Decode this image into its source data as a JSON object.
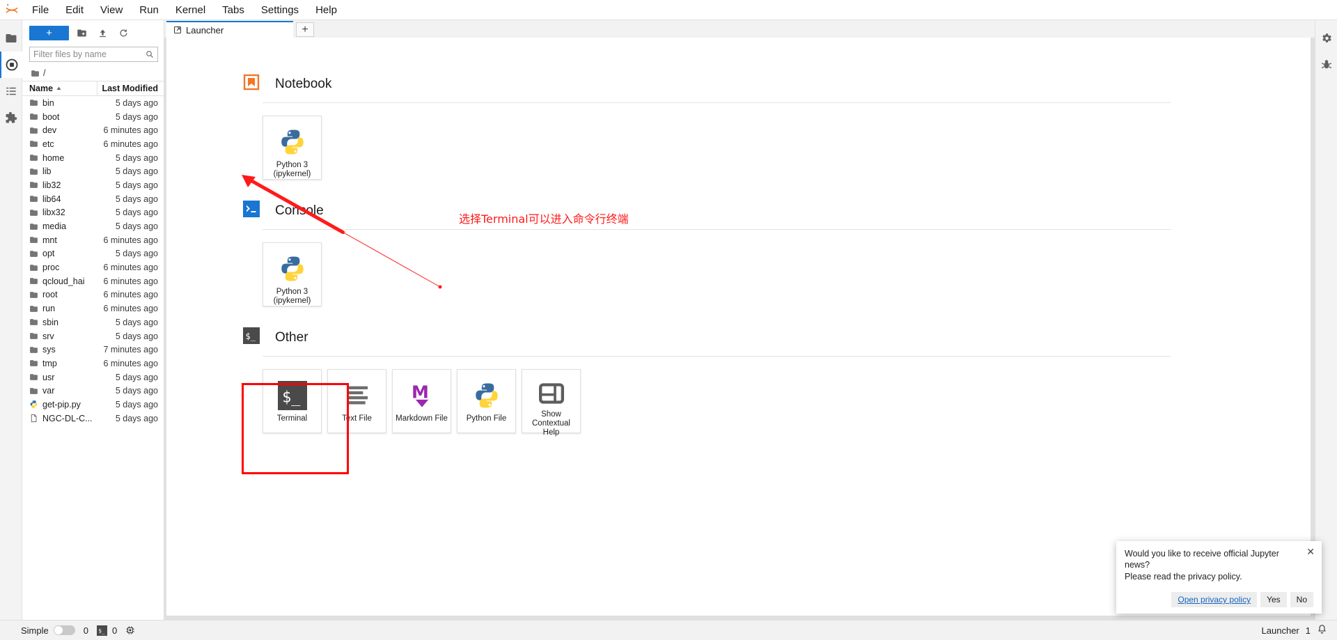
{
  "app": {
    "title": "JupyterLab",
    "logo_icon": "jupyter-logo-icon"
  },
  "menubar": {
    "items": [
      {
        "label": "File"
      },
      {
        "label": "Edit"
      },
      {
        "label": "View"
      },
      {
        "label": "Run"
      },
      {
        "label": "Kernel"
      },
      {
        "label": "Tabs"
      },
      {
        "label": "Settings"
      },
      {
        "label": "Help"
      }
    ]
  },
  "activitybar": {
    "items": [
      {
        "name": "file-browser-icon",
        "label": "File Browser"
      },
      {
        "name": "running-terminals-icon",
        "label": "Running Terminals and Kernels"
      },
      {
        "name": "table-of-contents-icon",
        "label": "Table of Contents"
      },
      {
        "name": "extension-manager-icon",
        "label": "Extension Manager"
      }
    ]
  },
  "rightbar": {
    "items": [
      {
        "name": "property-inspector-icon",
        "label": "Property Inspector"
      },
      {
        "name": "debugger-icon",
        "label": "Debugger"
      }
    ]
  },
  "filebrowser": {
    "new_launcher_label": "+",
    "toolbar_icons": [
      {
        "name": "new-folder-icon",
        "label": "New Folder"
      },
      {
        "name": "upload-icon",
        "label": "Upload Files"
      },
      {
        "name": "refresh-icon",
        "label": "Refresh File List"
      }
    ],
    "filter": {
      "placeholder": "Filter files by name",
      "value": ""
    },
    "breadcrumb": {
      "root": "/"
    },
    "columns": {
      "name": "Name",
      "last_modified": "Last Modified"
    },
    "sort": {
      "column": "Name",
      "direction": "ascending"
    },
    "items": [
      {
        "name": "bin",
        "modified": "5 days ago",
        "type": "folder"
      },
      {
        "name": "boot",
        "modified": "5 days ago",
        "type": "folder"
      },
      {
        "name": "dev",
        "modified": "6 minutes ago",
        "type": "folder"
      },
      {
        "name": "etc",
        "modified": "6 minutes ago",
        "type": "folder"
      },
      {
        "name": "home",
        "modified": "5 days ago",
        "type": "folder"
      },
      {
        "name": "lib",
        "modified": "5 days ago",
        "type": "folder"
      },
      {
        "name": "lib32",
        "modified": "5 days ago",
        "type": "folder"
      },
      {
        "name": "lib64",
        "modified": "5 days ago",
        "type": "folder"
      },
      {
        "name": "libx32",
        "modified": "5 days ago",
        "type": "folder"
      },
      {
        "name": "media",
        "modified": "5 days ago",
        "type": "folder"
      },
      {
        "name": "mnt",
        "modified": "6 minutes ago",
        "type": "folder"
      },
      {
        "name": "opt",
        "modified": "5 days ago",
        "type": "folder"
      },
      {
        "name": "proc",
        "modified": "6 minutes ago",
        "type": "folder"
      },
      {
        "name": "qcloud_hai",
        "modified": "6 minutes ago",
        "type": "folder"
      },
      {
        "name": "root",
        "modified": "6 minutes ago",
        "type": "folder"
      },
      {
        "name": "run",
        "modified": "6 minutes ago",
        "type": "folder"
      },
      {
        "name": "sbin",
        "modified": "5 days ago",
        "type": "folder"
      },
      {
        "name": "srv",
        "modified": "5 days ago",
        "type": "folder"
      },
      {
        "name": "sys",
        "modified": "7 minutes ago",
        "type": "folder"
      },
      {
        "name": "tmp",
        "modified": "6 minutes ago",
        "type": "folder"
      },
      {
        "name": "usr",
        "modified": "5 days ago",
        "type": "folder"
      },
      {
        "name": "var",
        "modified": "5 days ago",
        "type": "folder"
      },
      {
        "name": "get-pip.py",
        "modified": "5 days ago",
        "type": "python"
      },
      {
        "name": "NGC-DL-C...",
        "modified": "5 days ago",
        "type": "file"
      }
    ]
  },
  "tabbar": {
    "tabs": [
      {
        "label": "Launcher",
        "icon": "launcher-icon",
        "active": true
      }
    ],
    "add_tab_label": "+"
  },
  "launcher": {
    "sections": [
      {
        "title": "Notebook",
        "icon": "notebook-icon",
        "cards": [
          {
            "label": "Python 3\n(ipykernel)",
            "line1": "Python 3",
            "line2": "(ipykernel)",
            "icon": "python-logo-icon"
          }
        ]
      },
      {
        "title": "Console",
        "icon": "console-icon",
        "cards": [
          {
            "label": "Python 3\n(ipykernel)",
            "line1": "Python 3",
            "line2": "(ipykernel)",
            "icon": "python-logo-icon"
          }
        ]
      },
      {
        "title": "Other",
        "icon": "terminal-icon",
        "cards": [
          {
            "line1": "Terminal",
            "line2": "",
            "line3": "",
            "icon": "terminal-icon",
            "highlighted": true
          },
          {
            "line1": "Text File",
            "line2": "",
            "line3": "",
            "icon": "text-file-icon"
          },
          {
            "line1": "Markdown File",
            "line2": "",
            "line3": "",
            "icon": "markdown-icon"
          },
          {
            "line1": "Python File",
            "line2": "",
            "line3": "",
            "icon": "python-logo-icon"
          },
          {
            "line1": "Show",
            "line2": "Contextual",
            "line3": "Help",
            "icon": "contextual-help-icon"
          }
        ]
      }
    ]
  },
  "annotation": {
    "text": "选择Terminal可以进入命令行终端",
    "color": "#ff1a1a"
  },
  "toast": {
    "line1": "Would you like to receive official Jupyter",
    "line2": "news?",
    "line3": "Please read the privacy policy.",
    "close_label": "✕",
    "link_label": "Open privacy policy",
    "yes_label": "Yes",
    "no_label": "No"
  },
  "statusbar": {
    "mode_label": "Simple",
    "mode_on": false,
    "kernel_count": "0",
    "terminal_count": "0",
    "terminal_icon": "terminal-icon",
    "cpu_icon": "cpu-icon",
    "current_tab": "Launcher",
    "notification_count": "1",
    "bell_icon": "bell-icon"
  },
  "colors": {
    "accent": "#1976d2",
    "notebook_orange": "#f37726",
    "console_blue": "#1976d2",
    "terminal_dark": "#4a4a4a",
    "markdown_purple": "#9c27b0",
    "highlight_red": "#ff0000"
  }
}
